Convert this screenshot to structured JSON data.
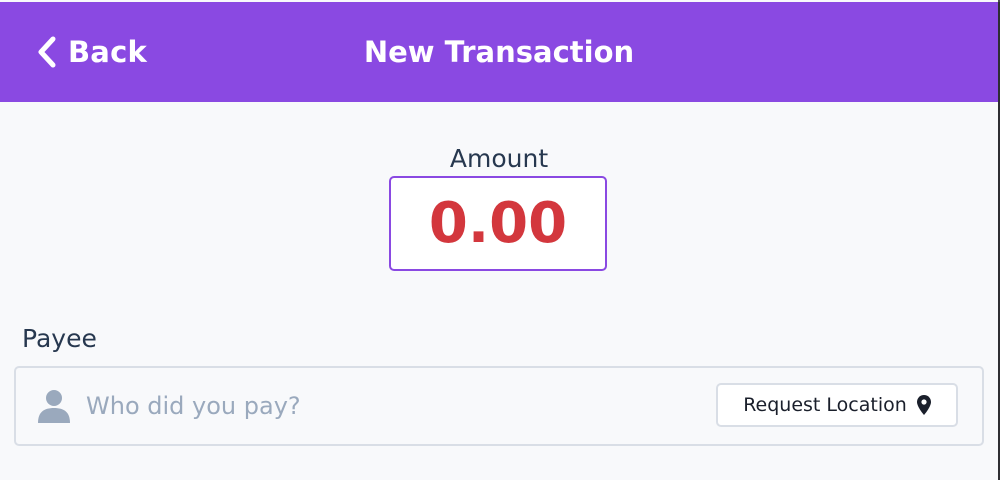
{
  "header": {
    "back_label": "Back",
    "title": "New Transaction"
  },
  "amount": {
    "label": "Amount",
    "value": "0.00"
  },
  "payee": {
    "label": "Payee",
    "placeholder": "Who did you pay?",
    "value": "",
    "request_location_label": "Request Location"
  },
  "icons": {
    "back": "chevron-left-icon",
    "user": "user-icon",
    "location": "map-pin-icon"
  },
  "colors": {
    "header_bg": "#8a49e2",
    "amount_text": "#d3373d",
    "amount_border": "#8a49e2",
    "text_primary": "#27384f",
    "placeholder": "#9aa9bd"
  }
}
